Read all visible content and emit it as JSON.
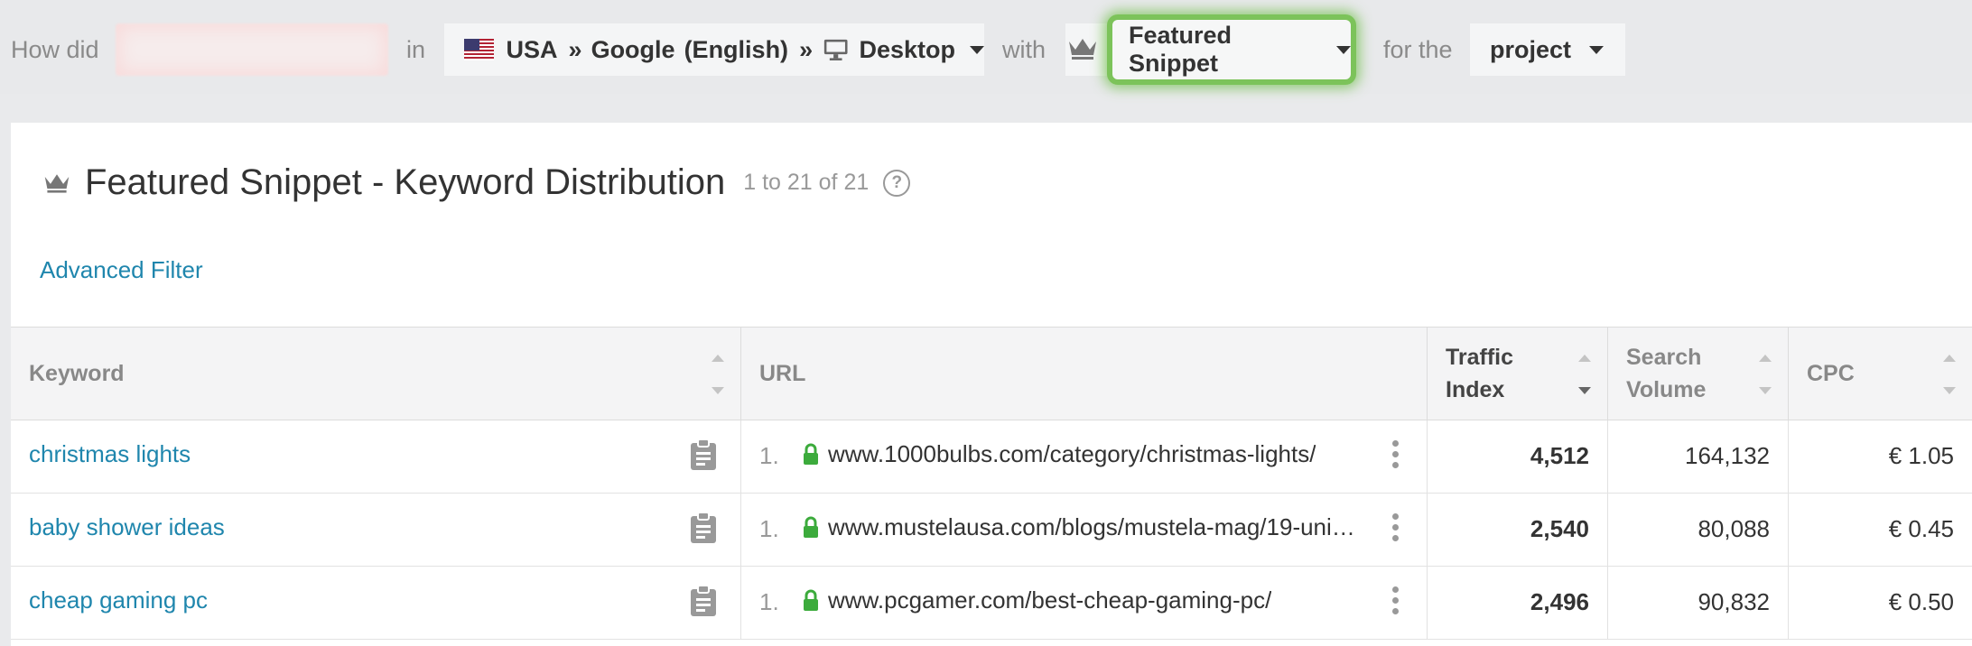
{
  "filter_bar": {
    "how_did": "How did",
    "in": "in",
    "country": "USA",
    "sep1": "»",
    "engine": "Google",
    "language": "(English)",
    "sep2": "»",
    "device": "Desktop",
    "with": "with",
    "feature": "Featured Snippet",
    "for_the": "for the",
    "scope": "project"
  },
  "panel": {
    "title": "Featured Snippet - Keyword Distribution",
    "count": "1 to 21 of 21",
    "help": "?",
    "advanced_filter": "Advanced Filter"
  },
  "table": {
    "columns": [
      "Keyword",
      "URL",
      "Traffic Index",
      "Search Volume",
      "CPC"
    ],
    "columns_lines": [
      [
        "Keyword"
      ],
      [
        "URL"
      ],
      [
        "Traffic",
        "Index"
      ],
      [
        "Search",
        "Volume"
      ],
      [
        "CPC"
      ]
    ],
    "sorted_column": "Traffic Index",
    "sort_direction": "descending",
    "rows": [
      {
        "keyword": "christmas lights",
        "rank": "1.",
        "url": "www.1000bulbs.com/category/christmas-lights/",
        "traffic_index": "4,512",
        "search_volume": "164,132",
        "cpc": "€ 1.05"
      },
      {
        "keyword": "baby shower ideas",
        "rank": "1.",
        "url": "www.mustelausa.com/blogs/mustela-mag/19-uni…",
        "traffic_index": "2,540",
        "search_volume": "80,088",
        "cpc": "€ 0.45"
      },
      {
        "keyword": "cheap gaming pc",
        "rank": "1.",
        "url": "www.pcgamer.com/best-cheap-gaming-pc/",
        "traffic_index": "2,496",
        "search_volume": "90,832",
        "cpc": "€ 0.50"
      }
    ]
  },
  "colors": {
    "link": "#1f86ad",
    "highlight": "#7cc35a",
    "lock": "#3cab3c"
  },
  "icons": [
    "us-flag-icon",
    "desktop-icon",
    "crown-icon",
    "help-icon",
    "clipboard-icon",
    "lock-icon",
    "more-vertical-icon",
    "sort-icon"
  ]
}
